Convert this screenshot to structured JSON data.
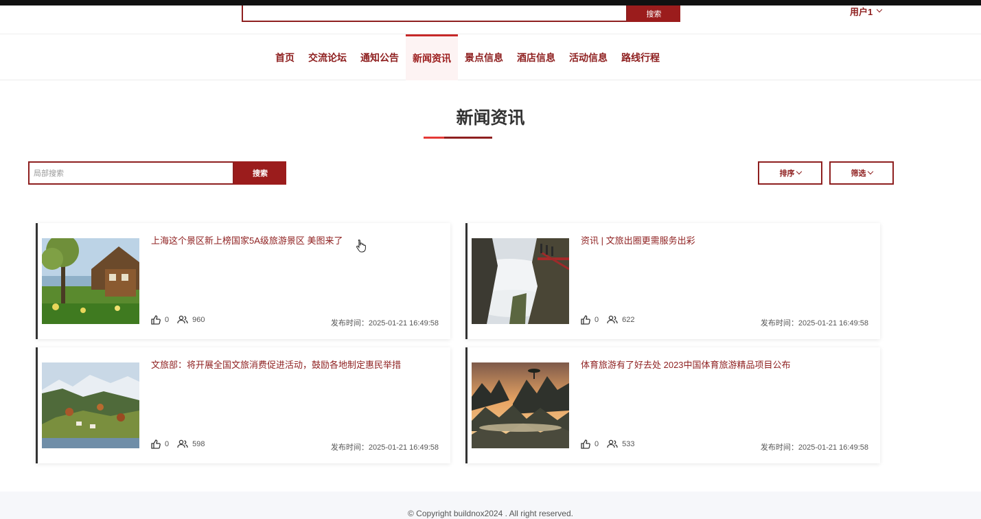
{
  "header": {
    "search_button": "搜索",
    "user_label": "用户1"
  },
  "nav": {
    "items": [
      "首页",
      "交流论坛",
      "通知公告",
      "新闻资讯",
      "景点信息",
      "酒店信息",
      "活动信息",
      "路线行程"
    ],
    "active": "新闻资讯"
  },
  "page": {
    "title": "新闻资讯",
    "search_placeholder": "局部搜索",
    "search_button": "搜索",
    "sort_button": "排序",
    "filter_button": "筛选"
  },
  "pubtime_label": "发布时间：",
  "news": [
    {
      "title": "上海这个景区新上榜国家5A级旅游景区 美图来了",
      "likes": "0",
      "views": "960",
      "time": "2025-01-21 16:49:58",
      "image": "lakeside-cabin-tree"
    },
    {
      "title": "资讯 | 文旅出圈更需服务出彩",
      "likes": "0",
      "views": "622",
      "time": "2025-01-21 16:49:58",
      "image": "cliff-walkway-clouds"
    },
    {
      "title": "文旅部：将开展全国文旅消费促进活动，鼓励各地制定惠民举措",
      "likes": "0",
      "views": "598",
      "time": "2025-01-21 16:49:58",
      "image": "alpine-village-lake"
    },
    {
      "title": "体育旅游有了好去处 2023中国体育旅游精品项目公布",
      "likes": "0",
      "views": "533",
      "time": "2025-01-21 16:49:58",
      "image": "misty-pine-mountains-sunset"
    }
  ],
  "footer": {
    "copyright": "© Copyright buildnox2024 . All right reserved."
  },
  "colors": {
    "brand": "#8e1f1f",
    "brand_button": "#9b1c1c",
    "accent_red": "#e53935"
  }
}
